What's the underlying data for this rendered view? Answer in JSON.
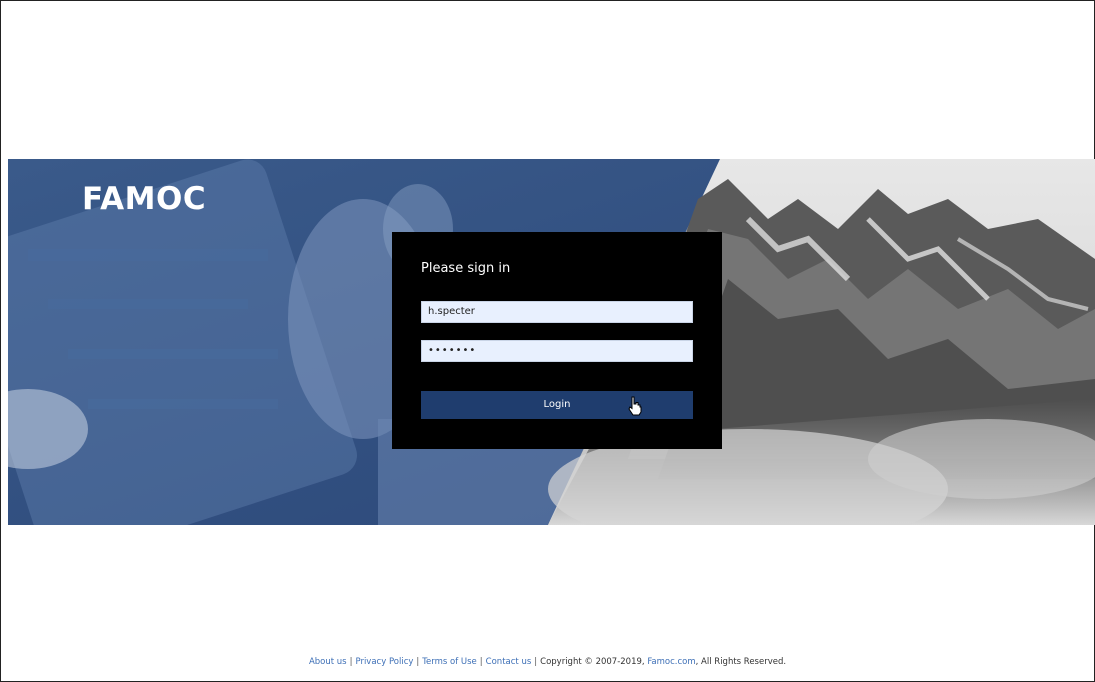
{
  "brand": {
    "logo_text": "FAMOC"
  },
  "login": {
    "title": "Please sign in",
    "username_value": "h.specter",
    "password_value": "•••••••",
    "login_label": "Login"
  },
  "footer": {
    "links": [
      "About us",
      "Privacy Policy",
      "Terms of Use",
      "Contact us"
    ],
    "separator": "|",
    "copyright_prefix": "Copyright © 2007-2019, ",
    "site_link": "Famoc.com",
    "copyright_suffix": ", All Rights Reserved."
  },
  "colors": {
    "hero_blue": "#2c4a78",
    "button_blue": "#1f3d6e",
    "input_bg": "#e8f0fe",
    "link_blue": "#3d6fb6"
  }
}
